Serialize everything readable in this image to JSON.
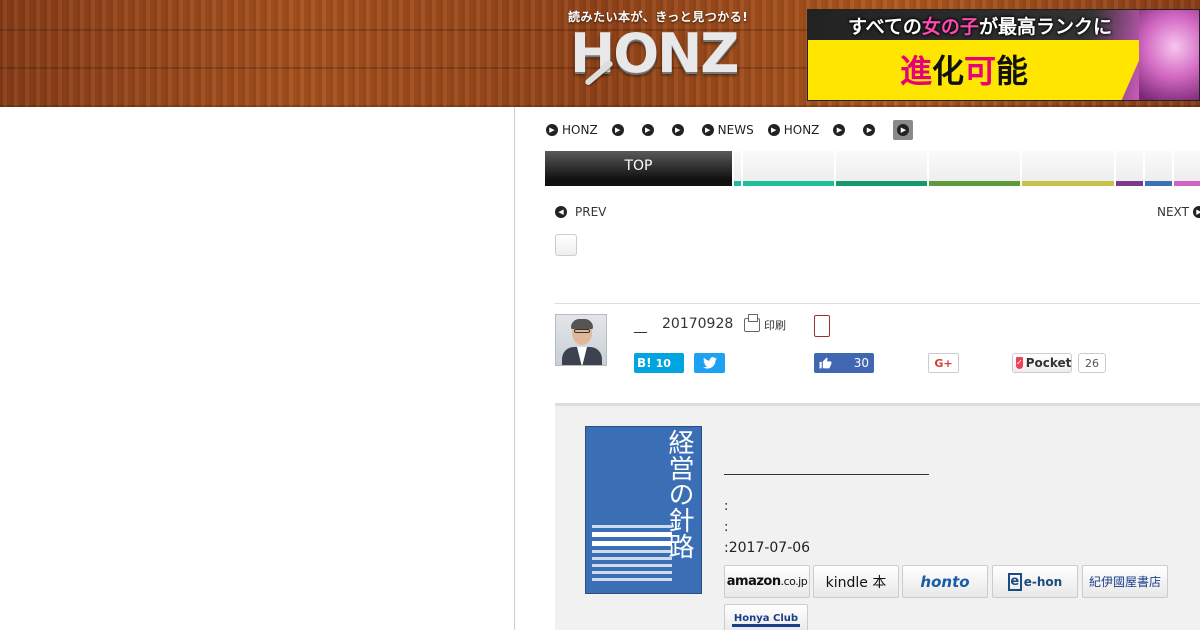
{
  "header": {
    "tagline": "読みたい本が、きっと見つかる!",
    "logo": "HONZ",
    "ad": {
      "line1_pre": "すべての",
      "line1_pink": "女の子",
      "line1_post": "が最高ランクに",
      "line2_a": "進",
      "line2_b": "化",
      "line2_c": "可",
      "line2_d": "能"
    }
  },
  "topnav": [
    "HONZ",
    "",
    "",
    "",
    "NEWS",
    "HONZ",
    "",
    ""
  ],
  "categories": {
    "top_label": "TOP",
    "stripes": [
      "#1fb9a5",
      "#1fbf9a",
      "#139a6a",
      "#5e9a3a",
      "#c8c24a",
      "#7a3a8a",
      "#3a72b8",
      "#d064c2"
    ]
  },
  "pager": {
    "prev": "PREV",
    "next": "NEXT"
  },
  "article": {
    "author_dash": "__",
    "date": "20170928",
    "print": "印刷"
  },
  "share": {
    "hatena_label": "B!",
    "hatena_count": "10",
    "fb_count": "30",
    "gplus": "G+",
    "pocket": "Pocket",
    "pocket_count": "26"
  },
  "book": {
    "cover_title": "経営の針路",
    "meta1": ":",
    "meta2": ":",
    "meta3": ":2017-07-06"
  },
  "retailers": {
    "amazon": "amazon",
    "amazon_jp": ".co.jp",
    "kindle": "kindle 本",
    "honto": "honto",
    "ehon": "e-hon",
    "kino": "紀伊國屋書店",
    "honya": "Honya Club"
  }
}
